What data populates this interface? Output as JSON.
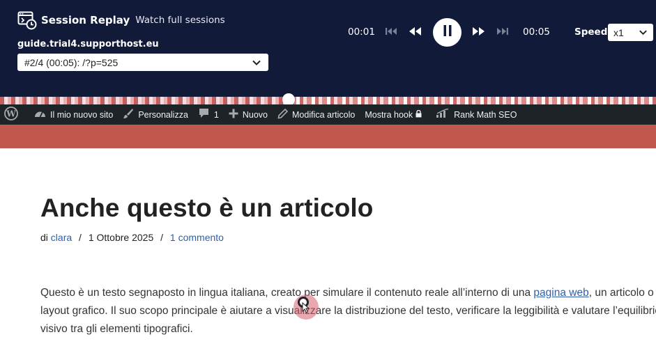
{
  "header": {
    "app_title": "Session Replay",
    "app_subtitle": "Watch full sessions",
    "domain": "guide.trial4.supporthost.eu",
    "session_select_value": "#2/4 (00:05): /?p=525",
    "time_current": "00:01",
    "time_total": "00:05",
    "speed_label": "Speed",
    "speed_value": "x1",
    "icons": {
      "brand": "replay-window-clock-icon",
      "first": "skip-to-start-icon",
      "back": "rewind-icon",
      "play": "pause-icon",
      "fwd": "fast-forward-icon",
      "last": "skip-to-end-icon"
    }
  },
  "timeline": {
    "progress_fraction": 0.44,
    "colors": {
      "event": "#c65a5a",
      "track": "#ffffff"
    }
  },
  "adminbar": {
    "items": [
      {
        "label": "",
        "icon": "wordpress-logo-icon"
      },
      {
        "label": "Il mio nuovo sito",
        "icon": "dashboard-gauge-icon"
      },
      {
        "label": "Personalizza",
        "icon": "paintbrush-icon"
      },
      {
        "label": "1",
        "icon": "comment-bubble-icon"
      },
      {
        "label": "Nuovo",
        "icon": "plus-icon"
      },
      {
        "label": "Modifica articolo",
        "icon": "pencil-icon"
      },
      {
        "label": "Mostra hook",
        "icon": "lock-icon"
      },
      {
        "label": "Rank Math SEO",
        "icon": "rank-math-chart-icon"
      }
    ]
  },
  "site": {
    "band_color": "#c0584e"
  },
  "article": {
    "title": "Anche questo è un articolo",
    "meta": {
      "prefix": "di",
      "author": "clara",
      "separator": "/",
      "date": "1 Ottobre 2025",
      "comments": "1 commento"
    },
    "paragraph": {
      "line1_before": "Questo è un testo segnaposto in lingua italiana, creato per simulare il contenuto reale all’interno di una ",
      "link": "pagina web",
      "line1_after": ", un articolo o un",
      "line2": "layout grafico. Il suo scopo principale è aiutare a visualizzare la distribuzione del testo, verificare la leggibilità e valutare l’equilibrio",
      "line3": "visivo tra gli elementi tipografici."
    }
  }
}
